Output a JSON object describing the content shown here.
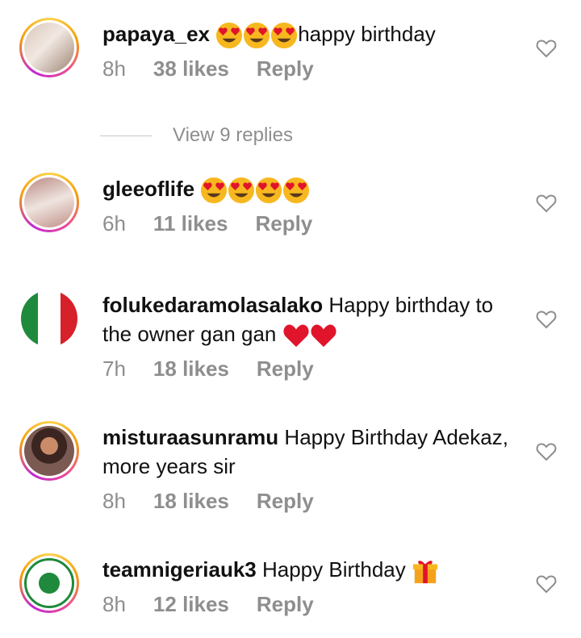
{
  "comments": [
    {
      "username": "papaya_ex",
      "text": "happy birthday",
      "emojis": [
        "heart-eyes",
        "heart-eyes",
        "heart-eyes"
      ],
      "time": "8h",
      "likes": "38 likes",
      "reply": "Reply"
    },
    {
      "username": "gleeoflife",
      "text": "",
      "emojis": [
        "heart-eyes",
        "heart-eyes",
        "heart-eyes",
        "heart-eyes"
      ],
      "time": "6h",
      "likes": "11 likes",
      "reply": "Reply"
    },
    {
      "username": "folukedaramolasalako",
      "text": "Happy birthday to the owner gan gan",
      "emojis": [
        "red-heart",
        "red-heart"
      ],
      "time": "7h",
      "likes": "18 likes",
      "reply": "Reply"
    },
    {
      "username": "misturaasunramu",
      "text": "Happy Birthday Adekaz, more years sir",
      "emojis": [],
      "time": "8h",
      "likes": "18 likes",
      "reply": "Reply"
    },
    {
      "username": "teamnigeriauk3",
      "text": "Happy Birthday",
      "emojis": [
        "wrapped-gift"
      ],
      "time": "8h",
      "likes": "12 likes",
      "reply": "Reply"
    }
  ],
  "view_replies": "View 9 replies",
  "colors": {
    "meta": "#8e8e8e",
    "text": "#111111",
    "heart_red": "#e0142b",
    "emoji_yellow": "#f7b81f"
  }
}
